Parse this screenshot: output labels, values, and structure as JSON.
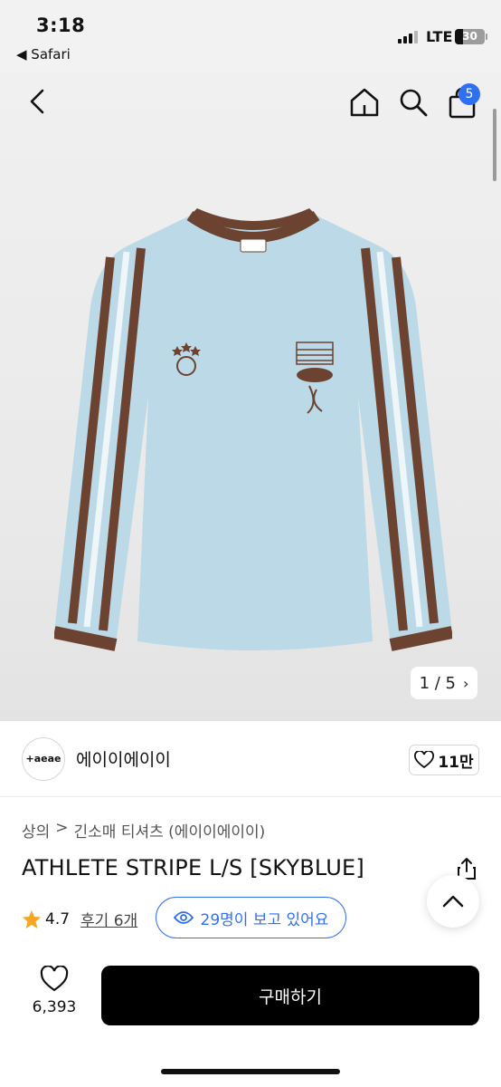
{
  "status_bar": {
    "time": "3:18",
    "back_app": "◀ Safari",
    "network": "LTE",
    "battery": "30"
  },
  "nav": {
    "back_icon": "chevron-left-icon",
    "home_icon": "home-icon",
    "search_icon": "search-icon",
    "cart_icon": "shopping-bag-icon",
    "cart_badge": "5"
  },
  "gallery": {
    "pager": "1 / 5"
  },
  "brand": {
    "logo_text": "+aeae",
    "name": "에이이에이이",
    "likes": "11만"
  },
  "product": {
    "breadcrumb": [
      "상의",
      ">",
      "긴소매 티셔츠 (에이이에이이)"
    ],
    "title": "ATHLETE STRIPE L/S [SKYBLUE]",
    "rating": "4.7",
    "reviews": "후기 6개",
    "viewers": "29명이 보고 있어요"
  },
  "bottom": {
    "wish_count": "6,393",
    "buy_label": "구매하기"
  },
  "colors": {
    "accent": "#2f6ff2",
    "star": "#f5a623",
    "shirt_body": "#bcd9e8",
    "shirt_trim": "#6b4330"
  }
}
